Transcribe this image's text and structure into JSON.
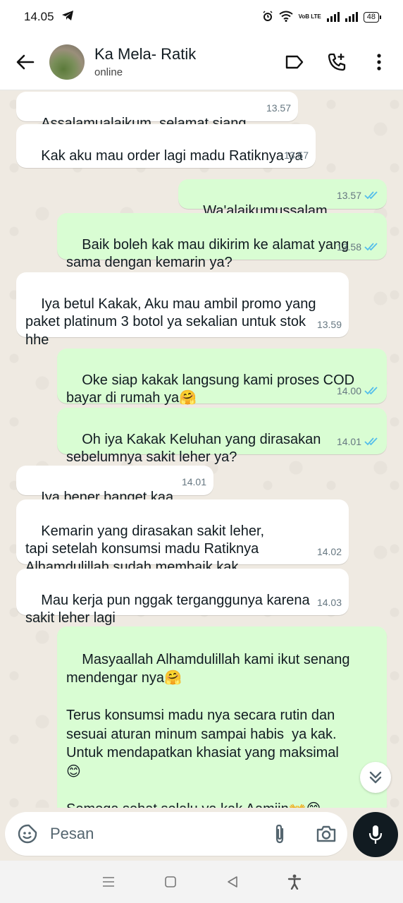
{
  "status_bar": {
    "time": "14.05",
    "network_label": "VoB LTE",
    "battery": "48"
  },
  "header": {
    "contact_name": "Ka Mela- Ratik",
    "contact_status": "online",
    "icons": [
      "back-arrow-icon",
      "label-icon",
      "add-call-icon",
      "more-vert-icon"
    ]
  },
  "messages": [
    {
      "dir": "in",
      "text": "Assalamualaikum, selamat siang",
      "time": "13.57"
    },
    {
      "dir": "in",
      "text": "Kak aku mau order lagi madu Ratiknya ya",
      "time": "13.57"
    },
    {
      "dir": "out",
      "text": "Wa'alaikumussalam",
      "time": "13.57",
      "read": true
    },
    {
      "dir": "out",
      "text": "Baik boleh kak mau dikirim ke alamat yang\nsama dengan kemarin ya?",
      "time": "13.58",
      "read": true
    },
    {
      "dir": "in",
      "text": "Iya betul Kakak, Aku mau ambil promo yang\npaket platinum 3 botol ya sekalian untuk stok\nhhe",
      "time": "13.59"
    },
    {
      "dir": "out",
      "text": "Oke siap kakak langsung kami proses COD\nbayar di rumah ya🤗",
      "time": "14.00",
      "read": true
    },
    {
      "dir": "out",
      "text": "Oh iya Kakak Keluhan yang dirasakan\nsebelumnya sakit leher ya?",
      "time": "14.01",
      "read": true
    },
    {
      "dir": "in",
      "text": "Iya bener banget kaa",
      "time": "14.01"
    },
    {
      "dir": "in",
      "text": "Kemarin yang dirasakan sakit leher,\ntapi setelah konsumsi madu Ratiknya\nAlhamdulillah sudah membaik kak.",
      "time": "14.02"
    },
    {
      "dir": "in",
      "text": "Mau kerja pun nggak terganggunya karena\nsakit leher lagi",
      "time": "14.03"
    },
    {
      "dir": "out",
      "text": "Masyaallah Alhamdulillah kami ikut senang\nmendengar nya🤗\n\nTerus konsumsi madu nya secara rutin dan\nsesuai aturan minum sampai habis  ya kak.\nUntuk mendapatkan khasiat yang maksimal\n😊\n\nSemoga sehat selalu ya kak Aamiin👐😊",
      "time": "",
      "read": false
    }
  ],
  "input": {
    "placeholder": "Pesan"
  },
  "colors": {
    "incoming_bubble": "#ffffff",
    "outgoing_bubble": "#d9fdd3",
    "chat_background": "#efeae2",
    "read_tick": "#53bdeb",
    "mic_button": "#111b21"
  }
}
